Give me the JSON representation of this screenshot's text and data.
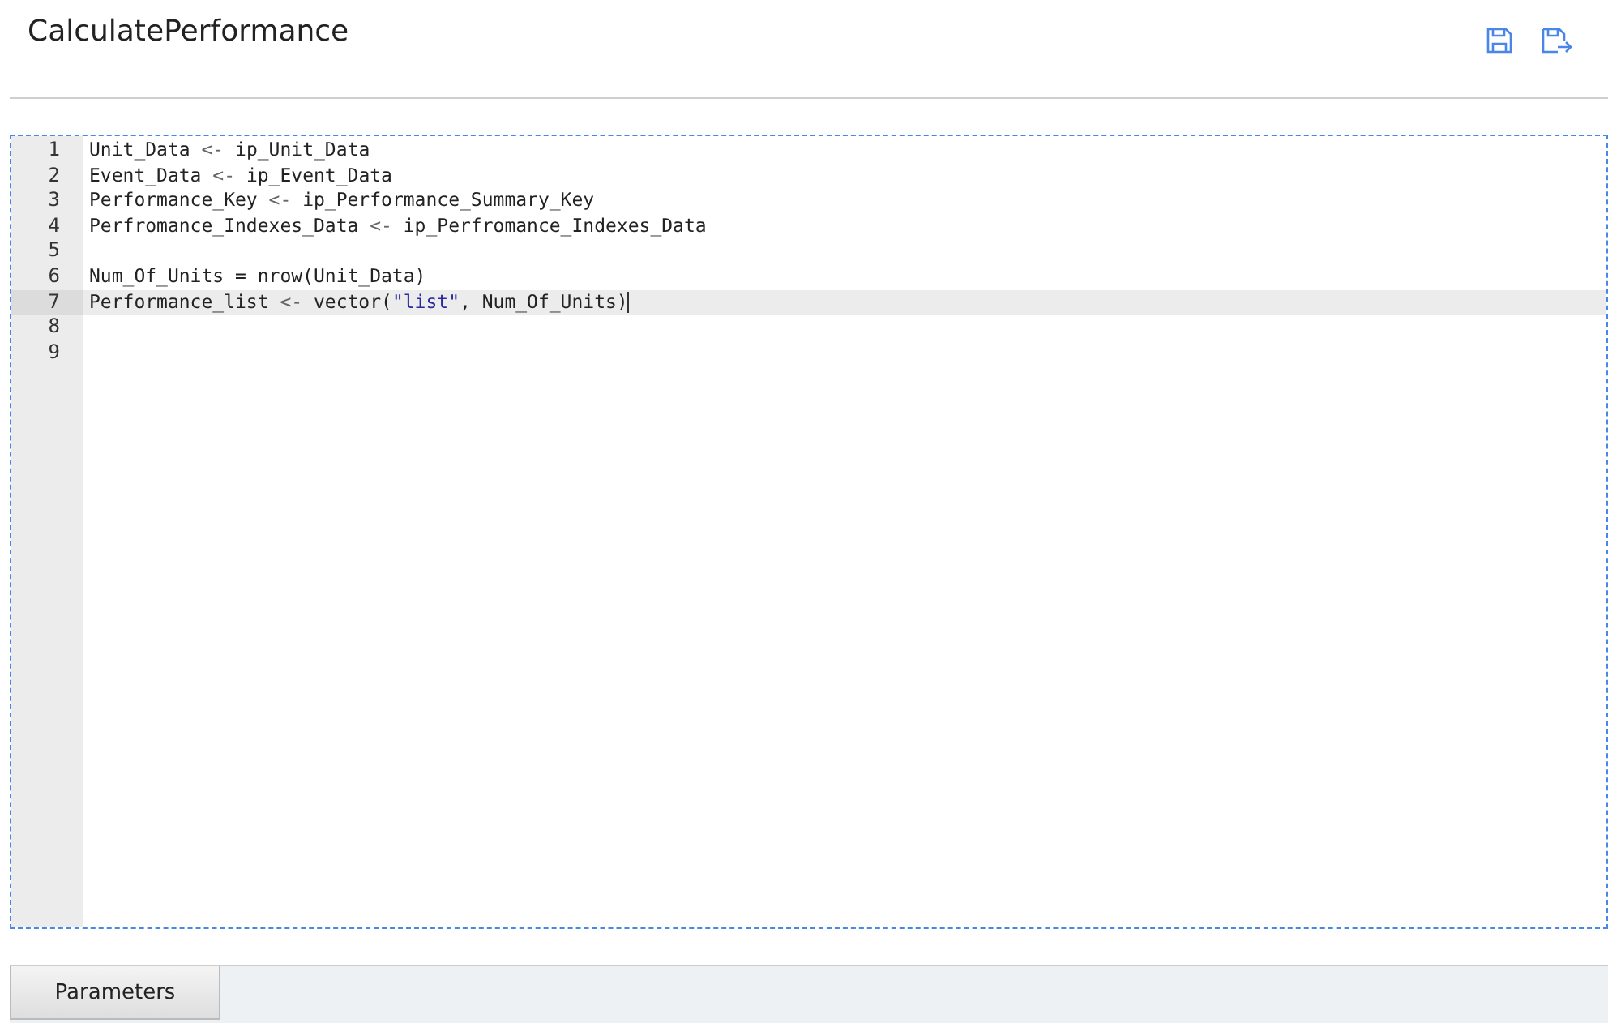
{
  "title": "CalculatePerformance",
  "editor": {
    "lines": [
      {
        "number": "1",
        "active": false,
        "tokens": [
          {
            "text": "Unit_Data ",
            "kind": "plain"
          },
          {
            "text": "<-",
            "kind": "op"
          },
          {
            "text": " ip_Unit_Data",
            "kind": "plain"
          }
        ]
      },
      {
        "number": "2",
        "active": false,
        "tokens": [
          {
            "text": "Event_Data ",
            "kind": "plain"
          },
          {
            "text": "<-",
            "kind": "op"
          },
          {
            "text": " ip_Event_Data",
            "kind": "plain"
          }
        ]
      },
      {
        "number": "3",
        "active": false,
        "tokens": [
          {
            "text": "Performance_Key ",
            "kind": "plain"
          },
          {
            "text": "<-",
            "kind": "op"
          },
          {
            "text": " ip_Performance_Summary_Key",
            "kind": "plain"
          }
        ]
      },
      {
        "number": "4",
        "active": false,
        "tokens": [
          {
            "text": "Perfromance_Indexes_Data ",
            "kind": "plain"
          },
          {
            "text": "<-",
            "kind": "op"
          },
          {
            "text": " ip_Perfromance_Indexes_Data",
            "kind": "plain"
          }
        ]
      },
      {
        "number": "5",
        "active": false
      },
      {
        "number": "6",
        "active": false,
        "tokens": [
          {
            "text": "Num_Of_Units = nrow(Unit_Data)",
            "kind": "plain"
          }
        ]
      },
      {
        "number": "7",
        "active": true,
        "tokens": [
          {
            "text": "Performance_list ",
            "kind": "plain"
          },
          {
            "text": "<-",
            "kind": "op"
          },
          {
            "text": " vector(",
            "kind": "plain"
          },
          {
            "text": "\"list\"",
            "kind": "string"
          },
          {
            "text": ", Num_Of_Units)",
            "kind": "plain"
          }
        ]
      },
      {
        "number": "8",
        "active": false
      },
      {
        "number": "9",
        "active": false
      }
    ]
  },
  "tabs": [
    {
      "label": "Parameters",
      "selected": true
    }
  ]
}
